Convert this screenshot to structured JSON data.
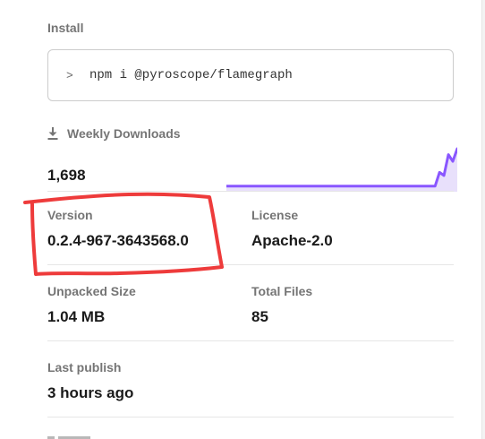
{
  "install": {
    "label": "Install",
    "prompt": ">",
    "command": "npm i @pyroscope/flamegraph"
  },
  "downloads": {
    "label": "Weekly Downloads",
    "value": "1,698",
    "icon": "download-icon",
    "sparkline_color": "#8956ff",
    "sparkline_fill": "#e8e0fb",
    "sparkline_values": [
      0.05,
      0.05,
      0.05,
      0.05,
      0.05,
      0.05,
      0.05,
      0.05,
      0.05,
      0.05,
      0.05,
      0.05,
      0.05,
      0.05,
      0.05,
      0.05,
      0.05,
      0.05,
      0.05,
      0.05,
      0.05,
      0.05,
      0.05,
      0.05,
      0.05,
      0.05,
      0.05,
      0.05,
      0.05,
      0.05,
      0.05,
      0.05,
      0.05,
      0.05,
      0.05,
      0.05,
      0.05,
      0.05,
      0.05,
      0.05,
      0.05,
      0.05,
      0.05,
      0.05,
      0.05,
      0.05,
      0.05,
      0.05,
      0.4,
      0.32,
      0.85,
      0.68,
      1.0
    ]
  },
  "version": {
    "label": "Version",
    "value": "0.2.4-967-3643568.0"
  },
  "license": {
    "label": "License",
    "value": "Apache-2.0"
  },
  "unpacked_size": {
    "label": "Unpacked Size",
    "value": "1.04 MB"
  },
  "total_files": {
    "label": "Total Files",
    "value": "85"
  },
  "last_publish": {
    "label": "Last publish",
    "value": "3 hours ago"
  },
  "annotation_color": "#ee3b3b"
}
